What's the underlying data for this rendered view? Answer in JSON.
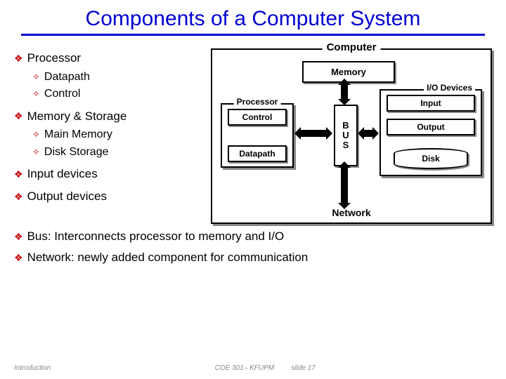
{
  "title": "Components of a Computer System",
  "bullets": {
    "processor": "Processor",
    "datapath": "Datapath",
    "control": "Control",
    "memstore": "Memory & Storage",
    "mainmem": "Main Memory",
    "diskstore": "Disk Storage",
    "inputdev": "Input devices",
    "outputdev": "Output devices",
    "bus": "Bus: Interconnects processor to memory and I/O",
    "network": "Network: newly added component for communication"
  },
  "diagram": {
    "computer": "Computer",
    "memory": "Memory",
    "processor": "Processor",
    "control": "Control",
    "datapath": "Datapath",
    "bus_b": "B",
    "bus_u": "U",
    "bus_s": "S",
    "io": "I/O Devices",
    "input": "Input",
    "output": "Output",
    "disk": "Disk",
    "network": "Network"
  },
  "footer": {
    "left": "Introduction",
    "mid": "COE 301– KFUPM",
    "right": "slide 17"
  }
}
